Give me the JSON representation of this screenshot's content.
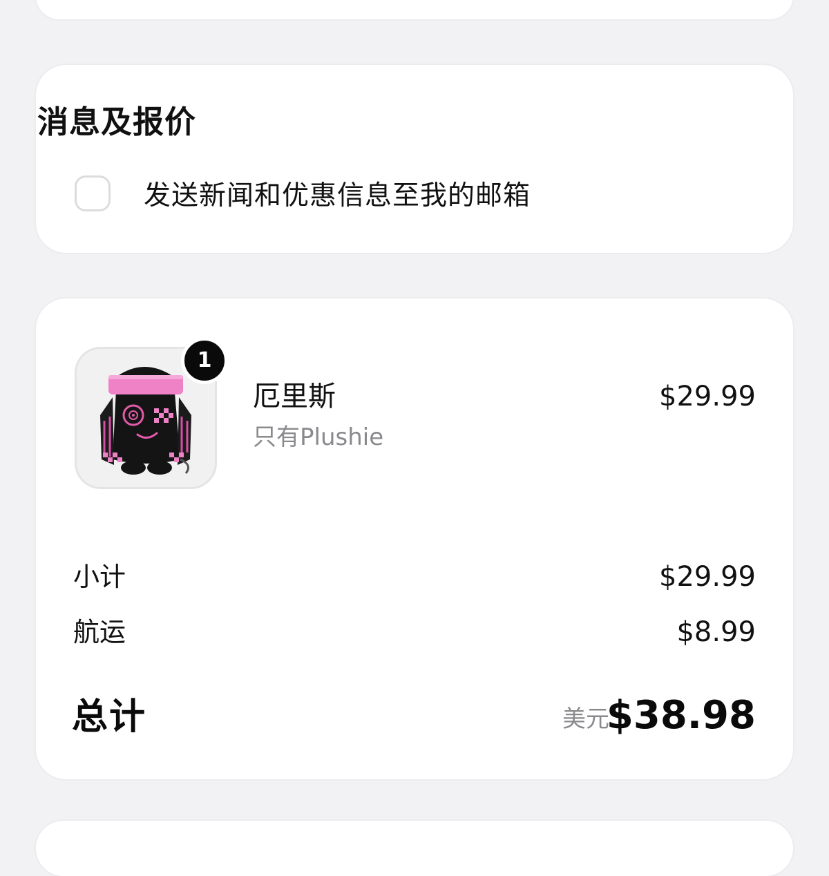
{
  "newsletter": {
    "title": "消息及报价",
    "checkbox_label": "发送新闻和优惠信息至我的邮箱",
    "checked": false
  },
  "order": {
    "item": {
      "name": "厄里斯",
      "variant": "只有Plushie",
      "price": "$29.99",
      "quantity": "1"
    },
    "subtotal": {
      "label": "小计",
      "value": "$29.99"
    },
    "shipping": {
      "label": "航运",
      "value": "$8.99"
    },
    "total": {
      "label": "总计",
      "currency": "美元",
      "value": "$38.98"
    }
  }
}
